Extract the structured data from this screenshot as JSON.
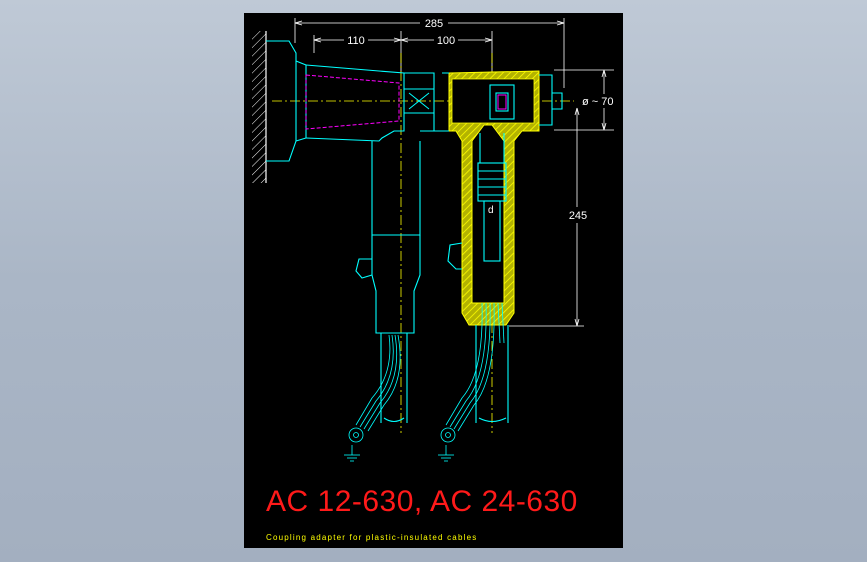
{
  "drawing": {
    "title": "AC 12-630, AC 24-630",
    "subtitle": "Coupling adapter for plastic-insulated cables",
    "dimensions": {
      "overall_width": "285",
      "left_span": "110",
      "right_span": "100",
      "height": "245",
      "diameter": "ø ~ 70",
      "label_d": "d"
    },
    "colors": {
      "background": "#000000",
      "title": "#ff1a1a",
      "subtitle": "#ffff00",
      "outline": "#00ffff",
      "hatch": "#ffff00",
      "insert": "#ff00ff",
      "dimension": "#ffffff"
    }
  }
}
